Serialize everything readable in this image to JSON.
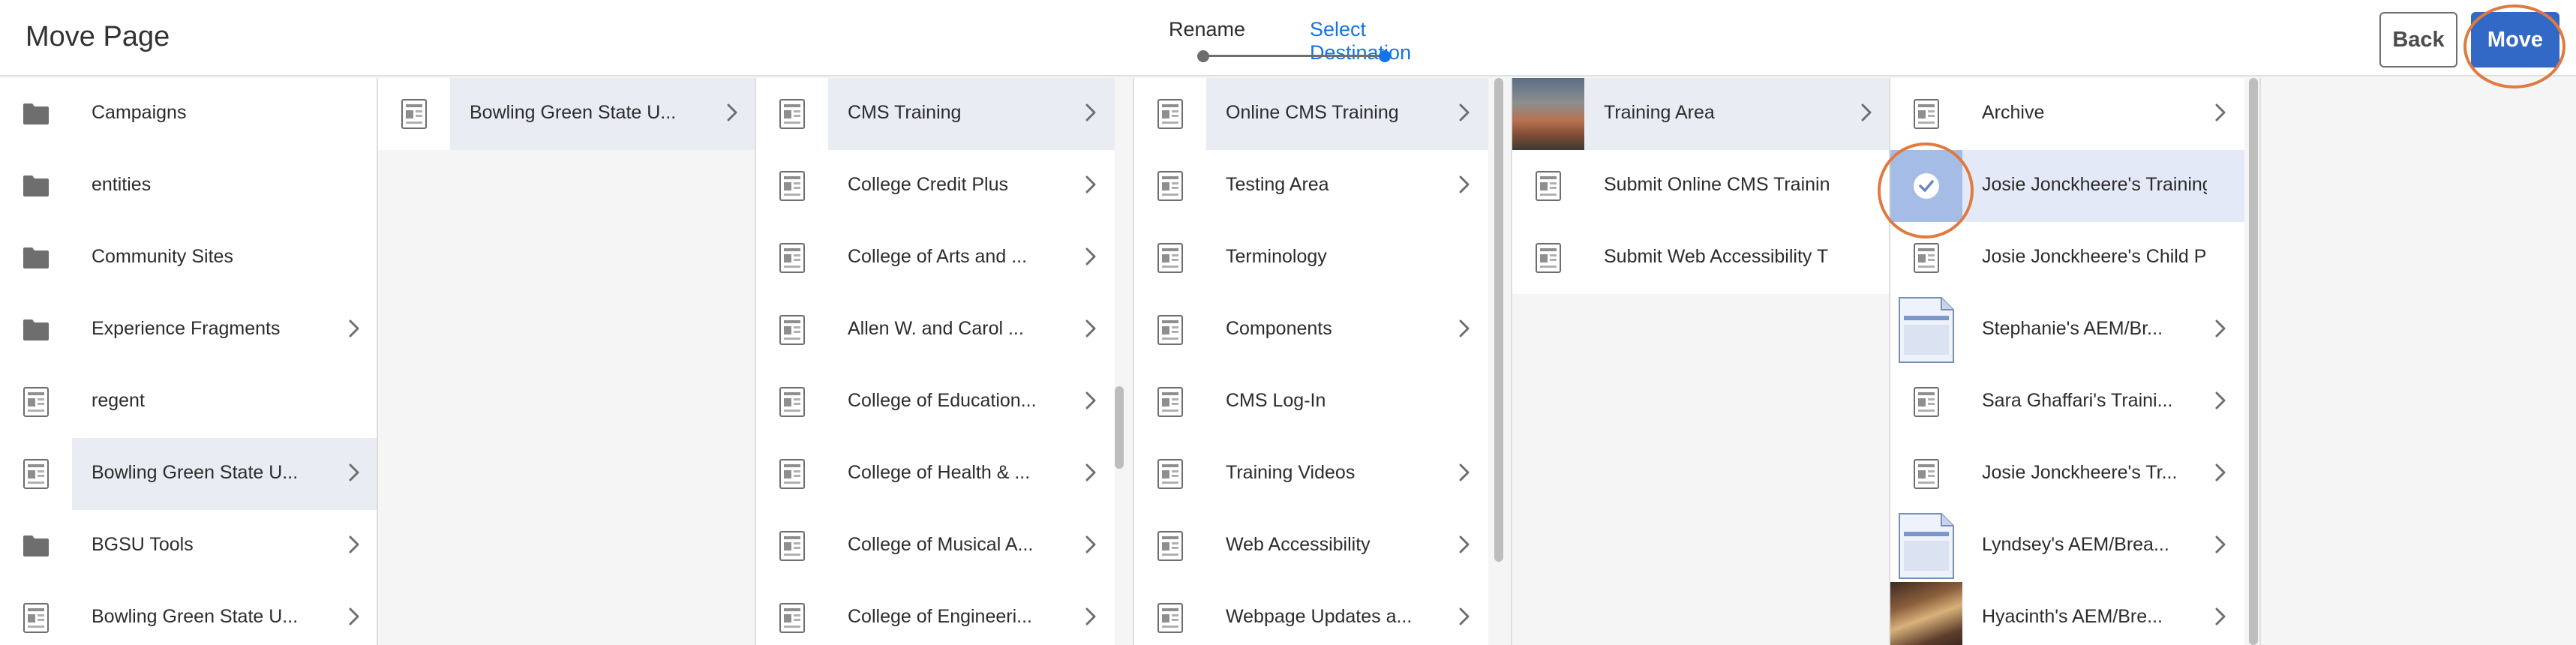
{
  "header": {
    "title": "Move Page",
    "steps": [
      "Rename",
      "Select Destination"
    ],
    "back_label": "Back",
    "move_label": "Move"
  },
  "icons": {
    "folder": "folder-icon",
    "page": "page-icon",
    "chevron": "chevron-right-icon",
    "check": "checkmark-icon"
  },
  "colors": {
    "accent": "#1473e6",
    "move_button": "#3369c6",
    "highlight_ring": "#e07a3f",
    "selected_row": "#e9ecf2"
  },
  "columns": [
    {
      "items": [
        {
          "label": "Campaigns",
          "icon": "folder",
          "chevron": false
        },
        {
          "label": "entities",
          "icon": "folder",
          "chevron": false
        },
        {
          "label": "Community Sites",
          "icon": "folder",
          "chevron": false
        },
        {
          "label": "Experience Fragments",
          "icon": "folder",
          "chevron": true
        },
        {
          "label": "regent",
          "icon": "page",
          "chevron": false
        },
        {
          "label": "Bowling Green State U...",
          "icon": "page",
          "chevron": true,
          "selected": true
        },
        {
          "label": "BGSU Tools",
          "icon": "folder",
          "chevron": true
        },
        {
          "label": "Bowling Green State U...",
          "icon": "page",
          "chevron": true
        }
      ]
    },
    {
      "items": [
        {
          "label": "Bowling Green State U...",
          "icon": "page",
          "chevron": true,
          "selected": true
        }
      ]
    },
    {
      "items": [
        {
          "label": "CMS Training",
          "icon": "page",
          "chevron": true,
          "selected": true
        },
        {
          "label": "College Credit Plus",
          "icon": "page",
          "chevron": true
        },
        {
          "label": "College of Arts and ...",
          "icon": "page",
          "chevron": true
        },
        {
          "label": "Allen W. and Carol ...",
          "icon": "page",
          "chevron": true
        },
        {
          "label": "College of Education...",
          "icon": "page",
          "chevron": true
        },
        {
          "label": "College of Health & ...",
          "icon": "page",
          "chevron": true
        },
        {
          "label": "College of Musical A...",
          "icon": "page",
          "chevron": true
        },
        {
          "label": "College of Engineeri...",
          "icon": "page",
          "chevron": true
        }
      ]
    },
    {
      "items": [
        {
          "label": "Online CMS Training",
          "icon": "page",
          "chevron": true,
          "selected": true
        },
        {
          "label": "Testing Area",
          "icon": "page",
          "chevron": true
        },
        {
          "label": "Terminology",
          "icon": "page",
          "chevron": false
        },
        {
          "label": "Components",
          "icon": "page",
          "chevron": true
        },
        {
          "label": "CMS Log-In",
          "icon": "page",
          "chevron": false
        },
        {
          "label": "Training Videos",
          "icon": "page",
          "chevron": true
        },
        {
          "label": "Web Accessibility",
          "icon": "page",
          "chevron": true
        },
        {
          "label": "Webpage Updates a...",
          "icon": "page",
          "chevron": true
        }
      ]
    },
    {
      "items": [
        {
          "label": "Training Area",
          "icon": "photo-1",
          "chevron": true,
          "selected": true
        },
        {
          "label": "Submit Online CMS Training",
          "icon": "page",
          "chevron": false
        },
        {
          "label": "Submit Web Accessibility Train...",
          "icon": "page",
          "chevron": false
        }
      ]
    },
    {
      "items": [
        {
          "label": "Archive",
          "icon": "page",
          "chevron": true
        },
        {
          "label": "Josie Jonckheere's Training ...",
          "icon": "check",
          "chevron": false,
          "checked": true
        },
        {
          "label": "Josie Jonckheere's Child Page",
          "icon": "page",
          "chevron": false
        },
        {
          "label": "Stephanie's AEM/Br...",
          "icon": "doc",
          "chevron": true
        },
        {
          "label": "Sara Ghaffari's Traini...",
          "icon": "page",
          "chevron": true
        },
        {
          "label": "Josie Jonckheere's Tr...",
          "icon": "page",
          "chevron": true
        },
        {
          "label": "Lyndsey's AEM/Brea...",
          "icon": "doc",
          "chevron": true
        },
        {
          "label": "Hyacinth's AEM/Bre...",
          "icon": "photo-2",
          "chevron": true
        }
      ]
    }
  ]
}
